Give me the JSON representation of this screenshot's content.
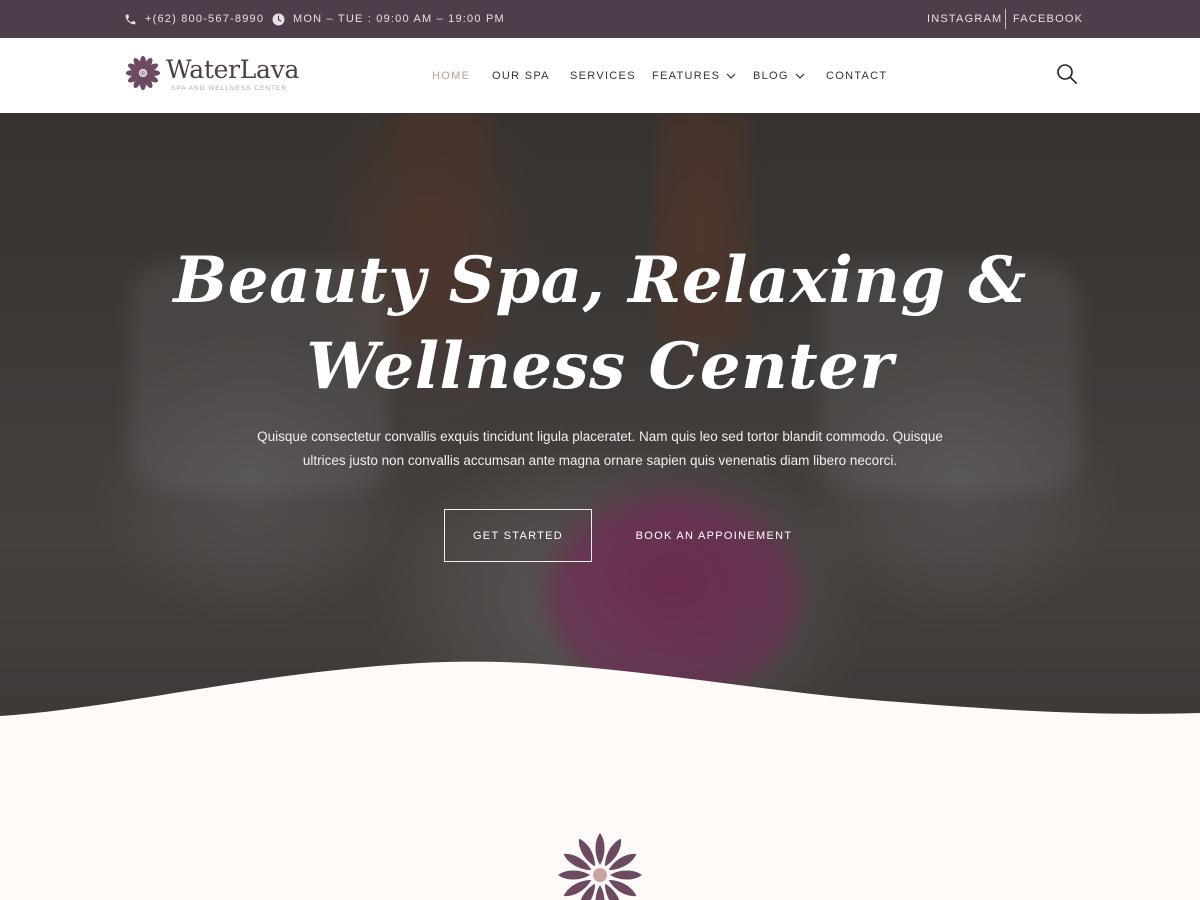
{
  "topbar": {
    "phone_icon": "phone-icon",
    "phone": "+(62) 800-567-8990",
    "clock_icon": "clock-icon",
    "hours": "MON – TUE : 09:00 AM – 19:00 PM",
    "social": [
      "INSTAGRAM",
      "FACEBOOK"
    ]
  },
  "logo": {
    "name": "WaterLava",
    "tagline": "SPA AND WELLNESS CENTER",
    "icon": "flower-icon"
  },
  "nav": {
    "items": [
      {
        "label": "HOME",
        "active": true
      },
      {
        "label": "OUR SPA"
      },
      {
        "label": "SERVICES"
      },
      {
        "label": "FEATURES",
        "dropdown": true
      },
      {
        "label": "BLOG",
        "dropdown": true
      },
      {
        "label": "CONTACT"
      }
    ],
    "search_icon": "search-icon"
  },
  "hero": {
    "title_line1": "Beauty Spa, Relaxing &",
    "title_line2": "Wellness Center",
    "description_line1": "Quisque consectetur convallis exquis tincidunt ligula placeratet. Nam quis leo sed tortor blandit commodo. Quisque",
    "description_line2": "ultrices justo non convallis accumsan ante magna ornare sapien quis venenatis diam libero necorci.",
    "primary_button": "GET STARTED",
    "secondary_button": "BOOK AN APPOINEMENT"
  },
  "colors": {
    "topbar_bg": "#4e3d4a",
    "brand": "#4e3d4a",
    "accent": "#bf9f8f",
    "page_bg": "#fdfaf7"
  }
}
